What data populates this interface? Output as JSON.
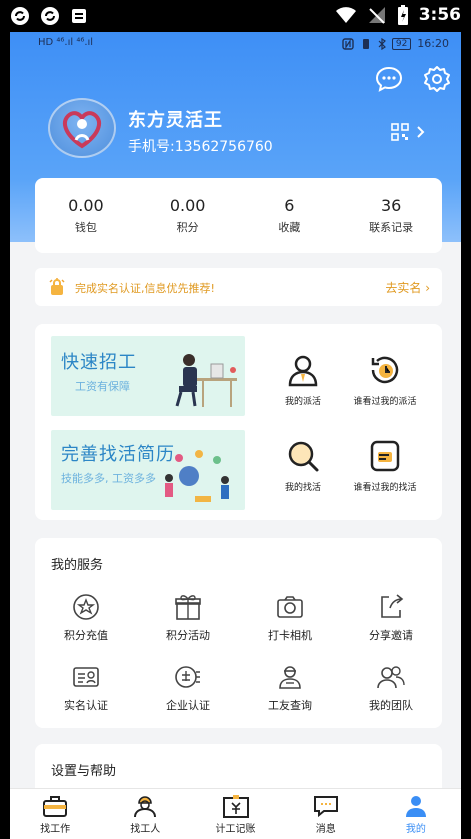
{
  "os_status": {
    "time": "3:56"
  },
  "inner_status": {
    "left": "HD ⁴⁶.ıl ⁴⁶.ıl",
    "battery": "92",
    "time": "16:20"
  },
  "profile": {
    "name": "东方灵活王",
    "phone": "手机号:13562756760"
  },
  "stats": [
    {
      "value": "0.00",
      "label": "钱包"
    },
    {
      "value": "0.00",
      "label": "积分"
    },
    {
      "value": "6",
      "label": "收藏"
    },
    {
      "value": "36",
      "label": "联系记录"
    }
  ],
  "notice": {
    "text": "完成实名认证,信息优先推荐!",
    "link": "去实名 ›"
  },
  "features": {
    "banner1": {
      "title": "快速招工",
      "subtitle": "工资有保障"
    },
    "banner2": {
      "title": "完善找活简历",
      "subtitle": "技能多多, 工资多多"
    },
    "items": [
      {
        "label": "我的派活",
        "icon": "person-icon"
      },
      {
        "label": "谁看过我的派活",
        "icon": "clock-history-icon"
      },
      {
        "label": "我的找活",
        "icon": "search-icon"
      },
      {
        "label": "谁看过我的找活",
        "icon": "document-icon"
      }
    ]
  },
  "services": {
    "title": "我的服务",
    "items": [
      {
        "label": "积分充值",
        "icon": "star-badge-icon"
      },
      {
        "label": "积分活动",
        "icon": "gift-icon"
      },
      {
        "label": "打卡相机",
        "icon": "camera-icon"
      },
      {
        "label": "分享邀请",
        "icon": "share-icon"
      },
      {
        "label": "实名认证",
        "icon": "id-card-icon"
      },
      {
        "label": "企业认证",
        "icon": "enterprise-icon"
      },
      {
        "label": "工友查询",
        "icon": "worker-icon"
      },
      {
        "label": "我的团队",
        "icon": "team-icon"
      }
    ]
  },
  "settings": {
    "title": "设置与帮助"
  },
  "tabbar": [
    {
      "label": "找工作",
      "icon": "briefcase-icon"
    },
    {
      "label": "找工人",
      "icon": "helmet-worker-icon"
    },
    {
      "label": "计工记账",
      "icon": "ledger-icon"
    },
    {
      "label": "消息",
      "icon": "message-icon"
    },
    {
      "label": "我的",
      "icon": "profile-icon",
      "active": true
    }
  ],
  "colors": {
    "primary": "#3a8ef5",
    "notice": "#e09a22",
    "banner_bg": "#dff5ee"
  }
}
